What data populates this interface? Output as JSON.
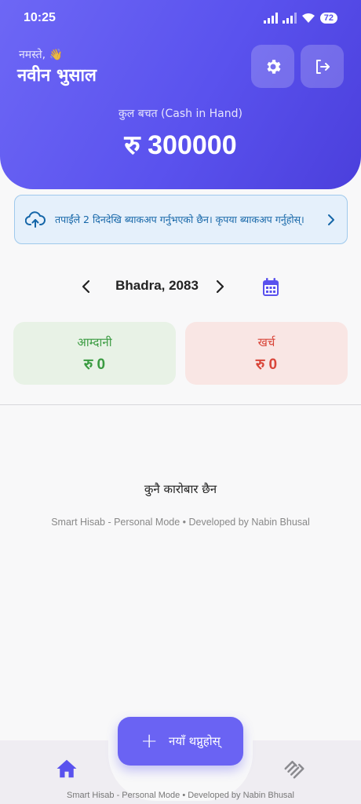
{
  "status_bar": {
    "time": "10:25",
    "battery": "72"
  },
  "header": {
    "greeting": "नमस्ते, 👋",
    "username": "नवीन भुसाल",
    "cash_label": "कुल बचत (Cash in Hand)",
    "cash_value": "रु 300000"
  },
  "backup_banner": {
    "text": "तपाईंले 2 दिनदेखि ब्याकअप गर्नुभएको छैन। कृपया ब्याकअप गर्नुहोस्।"
  },
  "month_selector": {
    "label": "Bhadra, 2083"
  },
  "summary": {
    "income_label": "आम्दानी",
    "income_value": "रु 0",
    "expense_label": "खर्च",
    "expense_value": "रु 0"
  },
  "empty_state": {
    "message": "कुनै कारोबार छैन"
  },
  "footer_credit": "Smart Hisab - Personal Mode • Developed by Nabin Bhusal",
  "fab": {
    "label": "नयाँ थप्नुहोस्"
  },
  "bottom_nav": {
    "credit": "Smart Hisab - Personal Mode • Developed by Nabin Bhusal"
  },
  "colors": {
    "primary": "#5a52ee",
    "income": "#3a9b41",
    "expense": "#d9463a",
    "banner_text": "#1566a8"
  }
}
